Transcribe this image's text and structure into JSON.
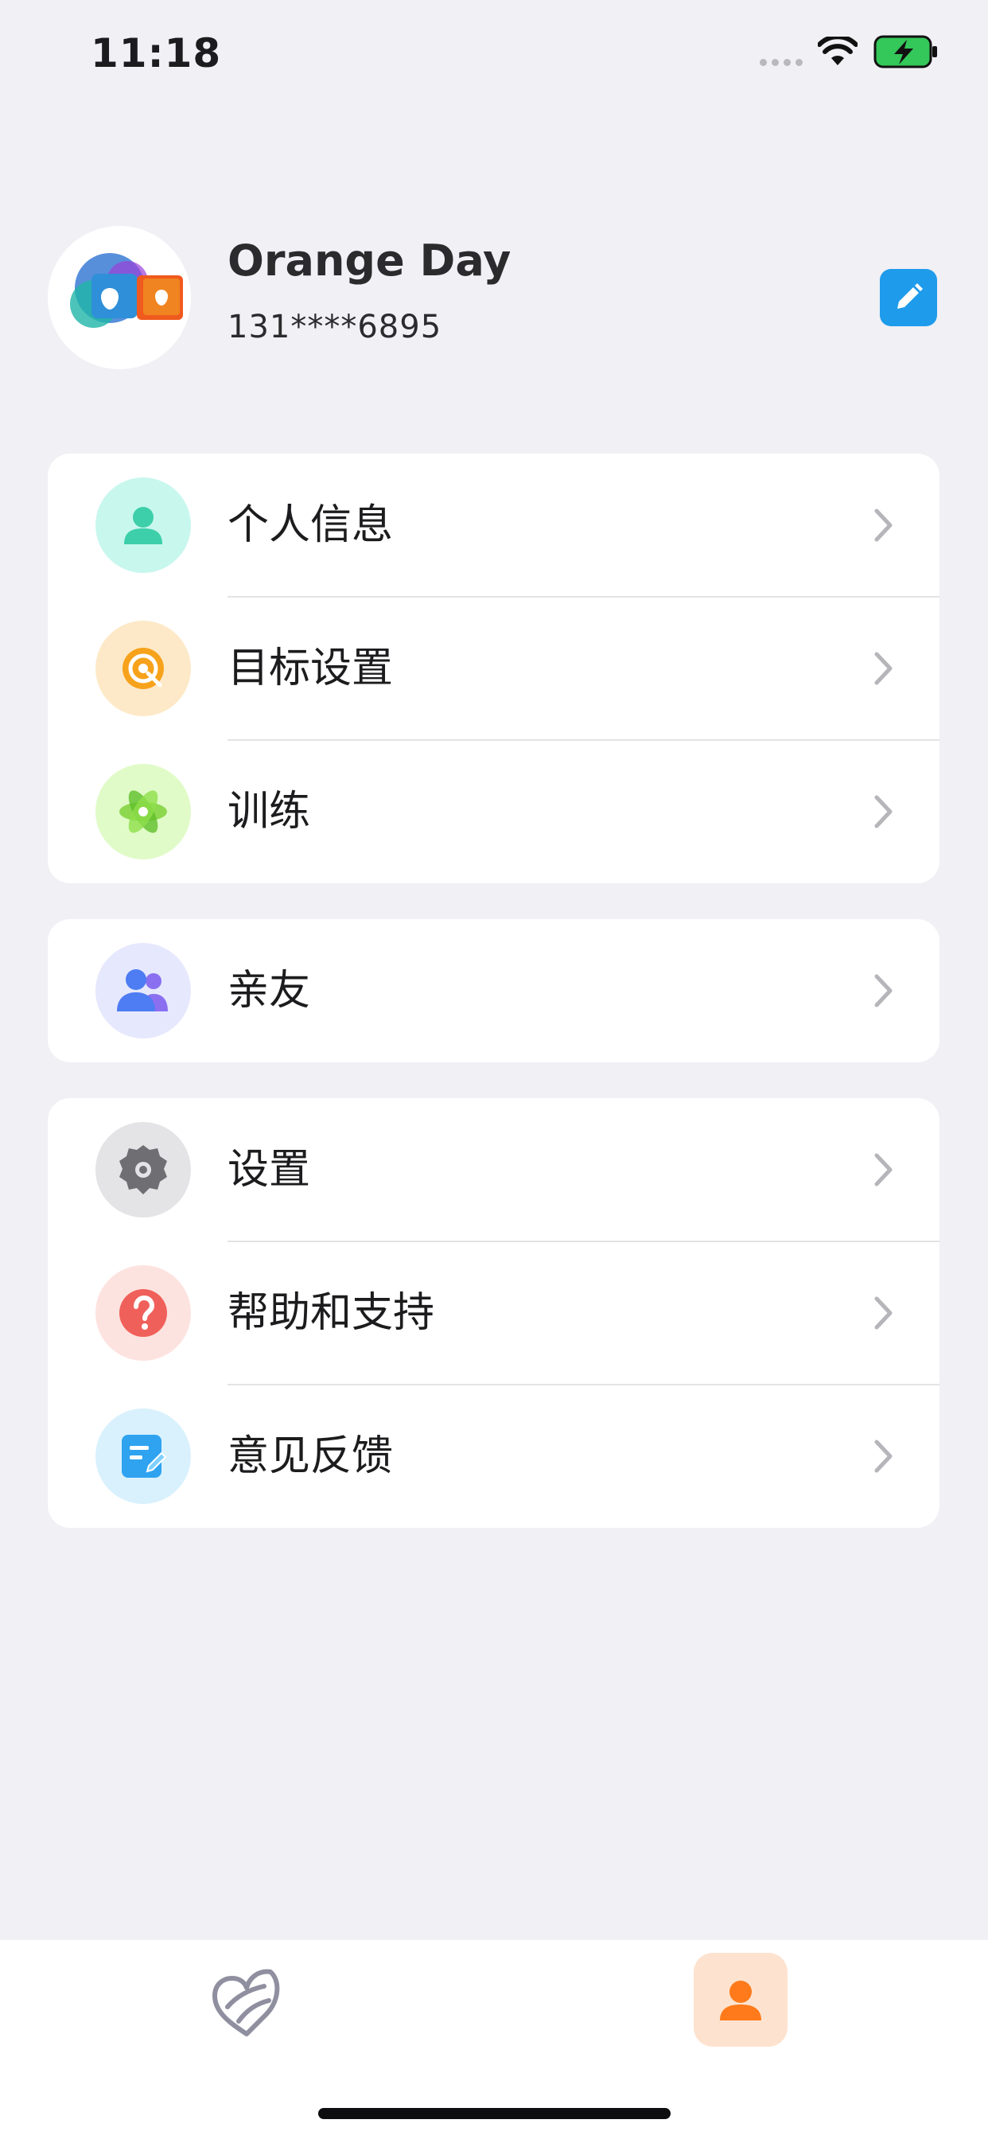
{
  "status_bar": {
    "time": "11:18"
  },
  "profile": {
    "name": "Orange Day",
    "phone": "131****6895"
  },
  "menu": {
    "group1": [
      {
        "label": "个人信息",
        "icon": "person-icon",
        "color": "#3dcfa9"
      },
      {
        "label": "目标设置",
        "icon": "target-icon",
        "color": "#f7a21b"
      },
      {
        "label": "训练",
        "icon": "atom-icon",
        "color": "#7fd13b"
      }
    ],
    "group2": [
      {
        "label": "亲友",
        "icon": "people-icon",
        "color": "#6a6ff0"
      }
    ],
    "group3": [
      {
        "label": "设置",
        "icon": "gear-icon",
        "color": "#6e6e73"
      },
      {
        "label": "帮助和支持",
        "icon": "question-icon",
        "color": "#f0605a"
      },
      {
        "label": "意见反馈",
        "icon": "feedback-icon",
        "color": "#2fa3f0"
      }
    ]
  },
  "tab_bar": {
    "tabs": [
      {
        "name": "home",
        "icon": "heart-leaf-icon",
        "active": false
      },
      {
        "name": "me",
        "icon": "person-icon",
        "active": true
      }
    ]
  },
  "colors": {
    "accent": "#ff7a1a",
    "edit_button": "#1e9bea",
    "background": "#f0f0f5"
  }
}
